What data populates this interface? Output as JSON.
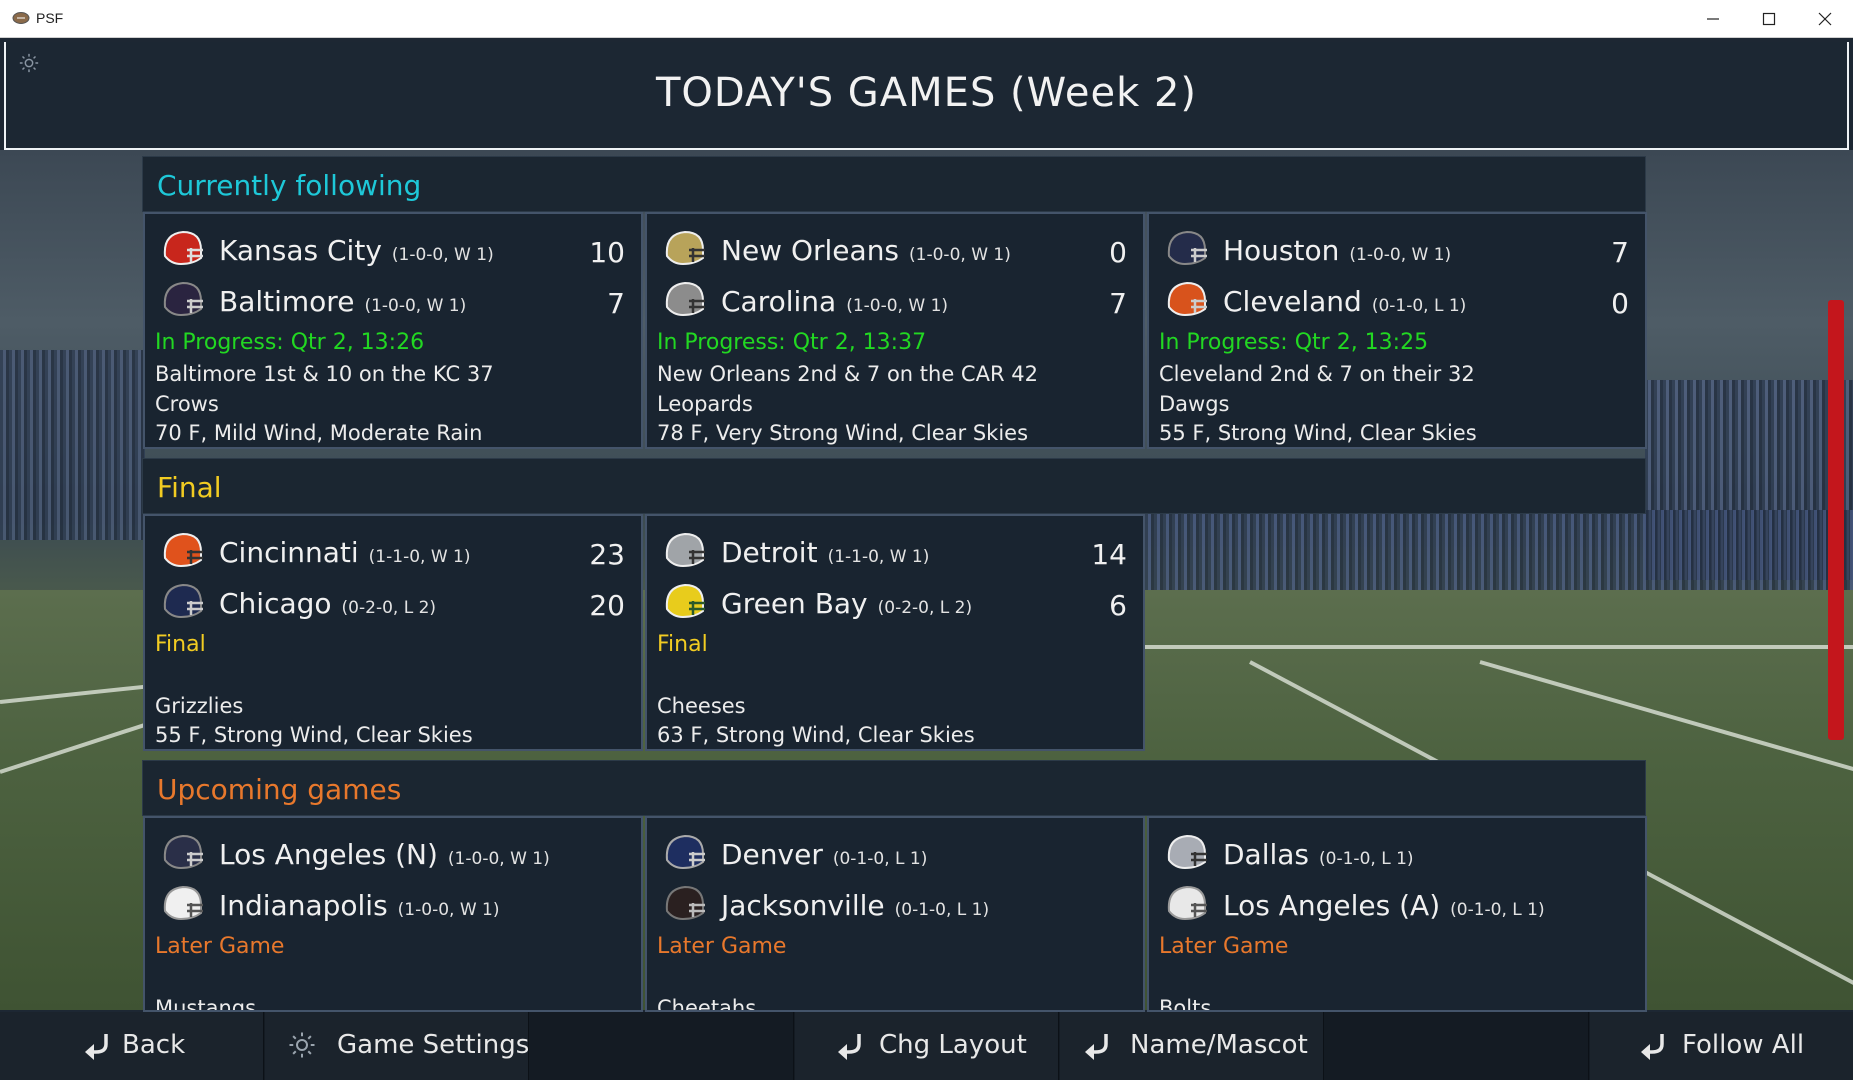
{
  "window": {
    "title": "PSF",
    "controls": [
      "minimize",
      "maximize",
      "close"
    ]
  },
  "header": {
    "title": "TODAY'S GAMES (Week 2)"
  },
  "colors": {
    "following": "#1ec8d8",
    "final": "#f2cc22",
    "upcoming": "#e8782c",
    "in_progress": "#22d822",
    "final_status": "#f2cc22",
    "later_status": "#e8782c",
    "panel_bg": "#192430",
    "side_accent": "#c4161c"
  },
  "sections": {
    "following": {
      "label": "Currently following",
      "games": [
        {
          "home": {
            "name": "Kansas City",
            "record": "(1-0-0, W 1)",
            "score": "10",
            "helmet": "#c8261c"
          },
          "away": {
            "name": "Baltimore",
            "record": "(1-0-0, W 1)",
            "score": "7",
            "helmet": "#2a2440"
          },
          "status": "In Progress: Qtr 2, 13:26",
          "situation": "Baltimore 1st & 10 on the KC 37",
          "mascot": "Crows",
          "weather": "70 F, Mild Wind, Moderate Rain"
        },
        {
          "home": {
            "name": "New Orleans",
            "record": "(1-0-0, W 1)",
            "score": "0",
            "helmet": "#b8a35a"
          },
          "away": {
            "name": "Carolina",
            "record": "(1-0-0, W 1)",
            "score": "7",
            "helmet": "#8c8c8c"
          },
          "status": "In Progress: Qtr 2, 13:37",
          "situation": "New Orleans 2nd & 7 on the CAR 42",
          "mascot": "Leopards",
          "weather": "78 F, Very Strong Wind, Clear Skies"
        },
        {
          "home": {
            "name": "Houston",
            "record": "(1-0-0, W 1)",
            "score": "7",
            "helmet": "#242c4a"
          },
          "away": {
            "name": "Cleveland",
            "record": "(0-1-0, L 1)",
            "score": "0",
            "helmet": "#d8531c"
          },
          "status": "In Progress: Qtr 2, 13:25",
          "situation": "Cleveland 2nd & 7 on their 32",
          "mascot": "Dawgs",
          "weather": "55 F, Strong Wind, Clear Skies"
        }
      ]
    },
    "final": {
      "label": "Final",
      "games": [
        {
          "home": {
            "name": "Cincinnati",
            "record": "(1-1-0, W 1)",
            "score": "23",
            "helmet": "#e0521c"
          },
          "away": {
            "name": "Chicago",
            "record": "(0-2-0, L 2)",
            "score": "20",
            "helmet": "#1e2a50"
          },
          "status": "Final",
          "mascot": "Grizzlies",
          "weather": "55 F, Strong Wind, Clear Skies"
        },
        {
          "home": {
            "name": "Detroit",
            "record": "(1-1-0, W 1)",
            "score": "14",
            "helmet": "#a0a4a8"
          },
          "away": {
            "name": "Green Bay",
            "record": "(0-2-0, L 2)",
            "score": "6",
            "helmet": "#e8cc1c"
          },
          "status": "Final",
          "mascot": "Cheeses",
          "weather": "63 F, Strong Wind, Clear Skies"
        }
      ]
    },
    "upcoming": {
      "label": "Upcoming games",
      "games": [
        {
          "home": {
            "name": "Los Angeles (N)",
            "record": "(1-0-0, W 1)",
            "helmet": "#2a2f48"
          },
          "away": {
            "name": "Indianapolis",
            "record": "(1-0-0, W 1)",
            "helmet": "#f0f0f0"
          },
          "status": "Later Game",
          "mascot": "Mustangs"
        },
        {
          "home": {
            "name": "Denver",
            "record": "(0-1-0, L 1)",
            "helmet": "#1e2e60"
          },
          "away": {
            "name": "Jacksonville",
            "record": "(0-1-0, L 1)",
            "helmet": "#2a2020"
          },
          "status": "Later Game",
          "mascot": "Cheetahs"
        },
        {
          "home": {
            "name": "Dallas",
            "record": "(0-1-0, L 1)",
            "helmet": "#a8acb4"
          },
          "away": {
            "name": "Los Angeles (A)",
            "record": "(0-1-0, L 1)",
            "helmet": "#e8e8e8"
          },
          "status": "Later Game",
          "mascot": "Bolts"
        }
      ]
    }
  },
  "bottom_bar": {
    "back": "Back",
    "game_settings": "Game Settings",
    "chg_layout": "Chg Layout",
    "name_mascot": "Name/Mascot",
    "follow_all": "Follow All"
  }
}
